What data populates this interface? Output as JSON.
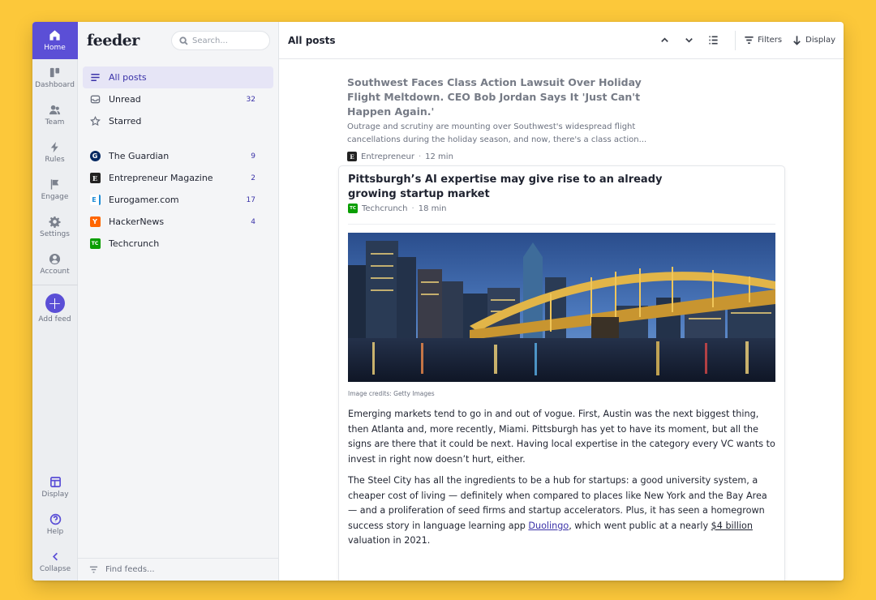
{
  "rail": {
    "items": [
      {
        "label": "Home",
        "icon": "home-icon"
      },
      {
        "label": "Dashboard",
        "icon": "dashboard-icon"
      },
      {
        "label": "Team",
        "icon": "team-icon"
      },
      {
        "label": "Rules",
        "icon": "bolt-icon"
      },
      {
        "label": "Engage",
        "icon": "flag-icon"
      },
      {
        "label": "Settings",
        "icon": "gear-icon"
      },
      {
        "label": "Account",
        "icon": "account-icon"
      }
    ],
    "add_feed": "Add feed",
    "bottom": [
      {
        "label": "Display",
        "icon": "layout-icon"
      },
      {
        "label": "Help",
        "icon": "help-icon"
      },
      {
        "label": "Collapse",
        "icon": "chevron-left-icon"
      }
    ]
  },
  "sidebar": {
    "logo": "feeder",
    "search_placeholder": "Search...",
    "nav": [
      {
        "label": "All posts",
        "count": ""
      },
      {
        "label": "Unread",
        "count": "32"
      },
      {
        "label": "Starred",
        "count": ""
      }
    ],
    "feeds": [
      {
        "label": "The Guardian",
        "count": "9",
        "badge": "G",
        "color": "#052962"
      },
      {
        "label": "Entrepreneur Magazine",
        "count": "2",
        "badge": "E",
        "color": "#222222"
      },
      {
        "label": "Eurogamer.com",
        "count": "17",
        "badge": "E",
        "color": "#1f8dd6"
      },
      {
        "label": "HackerNews",
        "count": "4",
        "badge": "Y",
        "color": "#ff6600"
      },
      {
        "label": "Techcrunch",
        "count": "",
        "badge": "TC",
        "color": "#0a9e01"
      }
    ],
    "footer": "Find feeds..."
  },
  "topbar": {
    "title": "All posts",
    "filters": "Filters",
    "display": "Display"
  },
  "articles": [
    {
      "title": "Southwest Faces Class Action Lawsuit Over Holiday Flight Meltdown. CEO Bob Jordan Says It 'Just Can't Happen Again.'",
      "excerpt": "Outrage and scrutiny are mounting over Southwest's widespread flight cancellations during the holiday season, and now, there's a class action...",
      "source": "Entrepreneur",
      "time": "12 min"
    },
    {
      "title": "Pittsburgh’s AI expertise may give rise to an already growing startup market",
      "source": "Techcrunch",
      "time": "18 min",
      "image_credit": "Image credits: Getty Images",
      "p1": "Emerging markets tend to go in and out of vogue. First, Austin was the next biggest thing, then Atlanta and, more recently, Miami. Pittsburgh has yet to have its moment, but all the signs are there that it could be next. Having local expertise in the category every VC wants to invest in right now doesn’t hurt, either.",
      "p2_before": "The Steel City has all the ingredients to be a hub for startups: a good university system, a cheaper cost of living — definitely when compared to places like New York and the Bay Area — and a proliferation of seed firms and startup accelerators. Plus, it has seen a homegrown success story in language learning app ",
      "p2_link1": "Duolingo",
      "p2_middle": ", which went public at a nearly ",
      "p2_link2": "$4 billion",
      "p2_after": " valuation in 2021."
    }
  ],
  "colors": {
    "accent": "#5b4fd6",
    "background": "#fcc83a"
  }
}
